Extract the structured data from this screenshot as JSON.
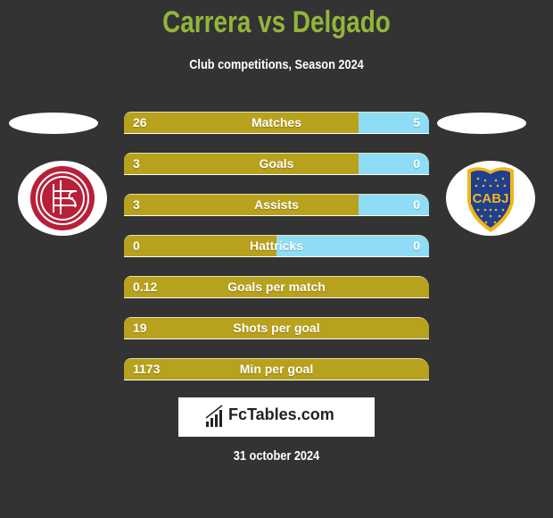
{
  "header": {
    "title": "Carrera vs Delgado",
    "subtitle": "Club competitions, Season 2024"
  },
  "colors": {
    "title": "#93b53a",
    "left_bar": "#b8a11c",
    "right_bar": "#8fdcf6",
    "background": "#333333"
  },
  "teams": {
    "left": {
      "badge": "lanus-crest-icon"
    },
    "right": {
      "badge": "boca-juniors-crest-icon",
      "badge_text": "CABJ"
    }
  },
  "stats": [
    {
      "label": "Matches",
      "left": "26",
      "right": "5",
      "left_share": 0.77
    },
    {
      "label": "Goals",
      "left": "3",
      "right": "0",
      "left_share": 0.77
    },
    {
      "label": "Assists",
      "left": "3",
      "right": "0",
      "left_share": 0.77
    },
    {
      "label": "Hattricks",
      "left": "0",
      "right": "0",
      "left_share": 0.5
    },
    {
      "label": "Goals per match",
      "left": "0.12",
      "right": "",
      "left_share": 1.0
    },
    {
      "label": "Shots per goal",
      "left": "19",
      "right": "",
      "left_share": 1.0
    },
    {
      "label": "Min per goal",
      "left": "1173",
      "right": "",
      "left_share": 1.0
    }
  ],
  "footer": {
    "brand": "FcTables.com",
    "date": "31 october 2024"
  }
}
